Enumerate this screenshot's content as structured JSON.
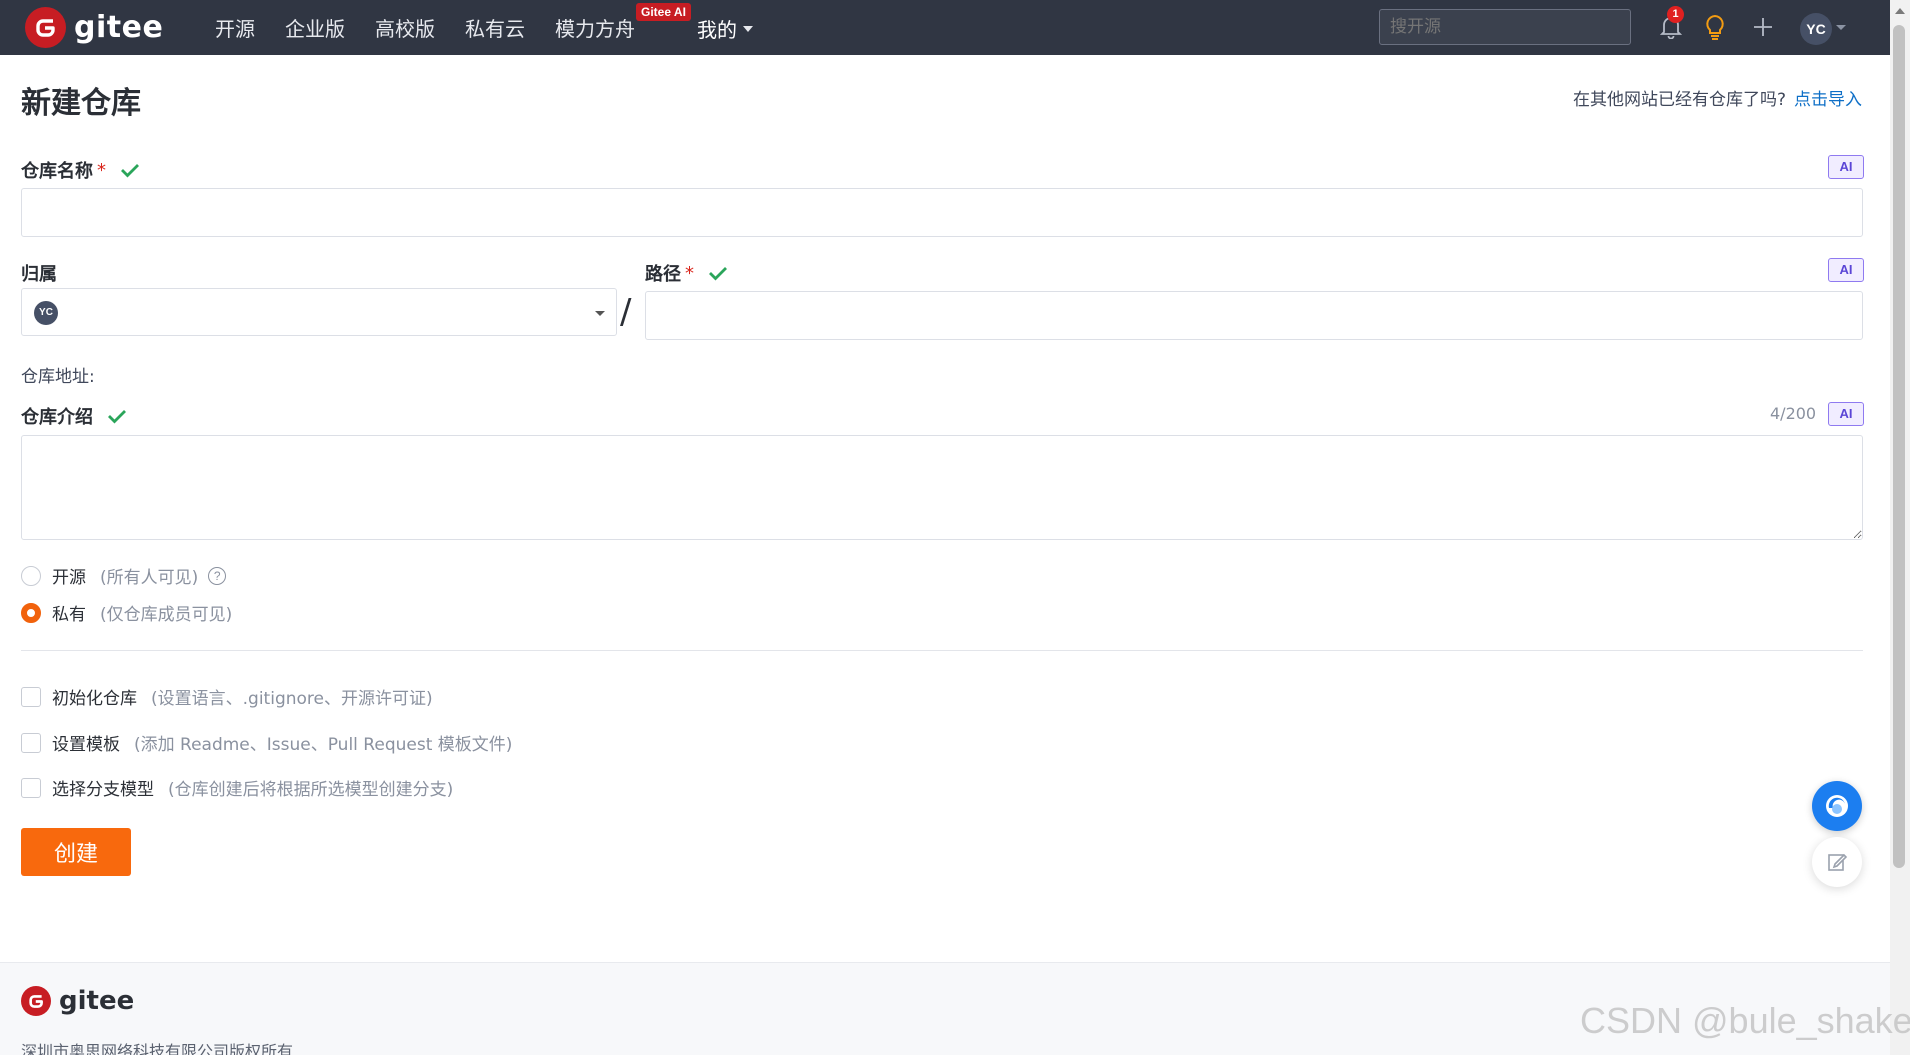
{
  "nav": {
    "brand": "gitee",
    "links": [
      "开源",
      "企业版",
      "高校版",
      "私有云",
      "模力方舟"
    ],
    "ai_badge": "Gitee AI",
    "mine": "我的",
    "search_placeholder": "搜开源",
    "notification_count": "1",
    "avatar_initials": "YC"
  },
  "page": {
    "title": "新建仓库",
    "import_prompt": "在其他网站已经有仓库了吗?",
    "import_link": "点击导入"
  },
  "form": {
    "repo_name_label": "仓库名称",
    "required_mark": "*",
    "ai_label": "AI",
    "owner_label": "归属",
    "owner_avatar": "YC",
    "path_label": "路径",
    "slash": "/",
    "address_label": "仓库地址:",
    "intro_label": "仓库介绍",
    "intro_counter": "4/200",
    "visibility": {
      "public_label": "开源",
      "public_hint": "(所有人可见)",
      "private_label": "私有",
      "private_hint": "(仅仓库成员可见)",
      "selected": "private"
    },
    "options": [
      {
        "label": "初始化仓库",
        "hint": "(设置语言、.gitignore、开源许可证)"
      },
      {
        "label": "设置模板",
        "hint": "(添加 Readme、Issue、Pull Request 模板文件)"
      },
      {
        "label": "选择分支模型",
        "hint": "(仓库创建后将根据所选模型创建分支)"
      }
    ],
    "submit_label": "创建"
  },
  "footer": {
    "brand": "gitee",
    "copyright": "深圳市奥思网络科技有限公司版权所有"
  },
  "watermark": "CSDN @bule_shake",
  "colors": {
    "nav_bg": "#303643",
    "brand_red": "#c71d23",
    "accent_orange": "#f8690d",
    "link_blue": "#0e6fc7",
    "ai_purple": "#5b46d6",
    "check_green": "#2aa55a"
  }
}
